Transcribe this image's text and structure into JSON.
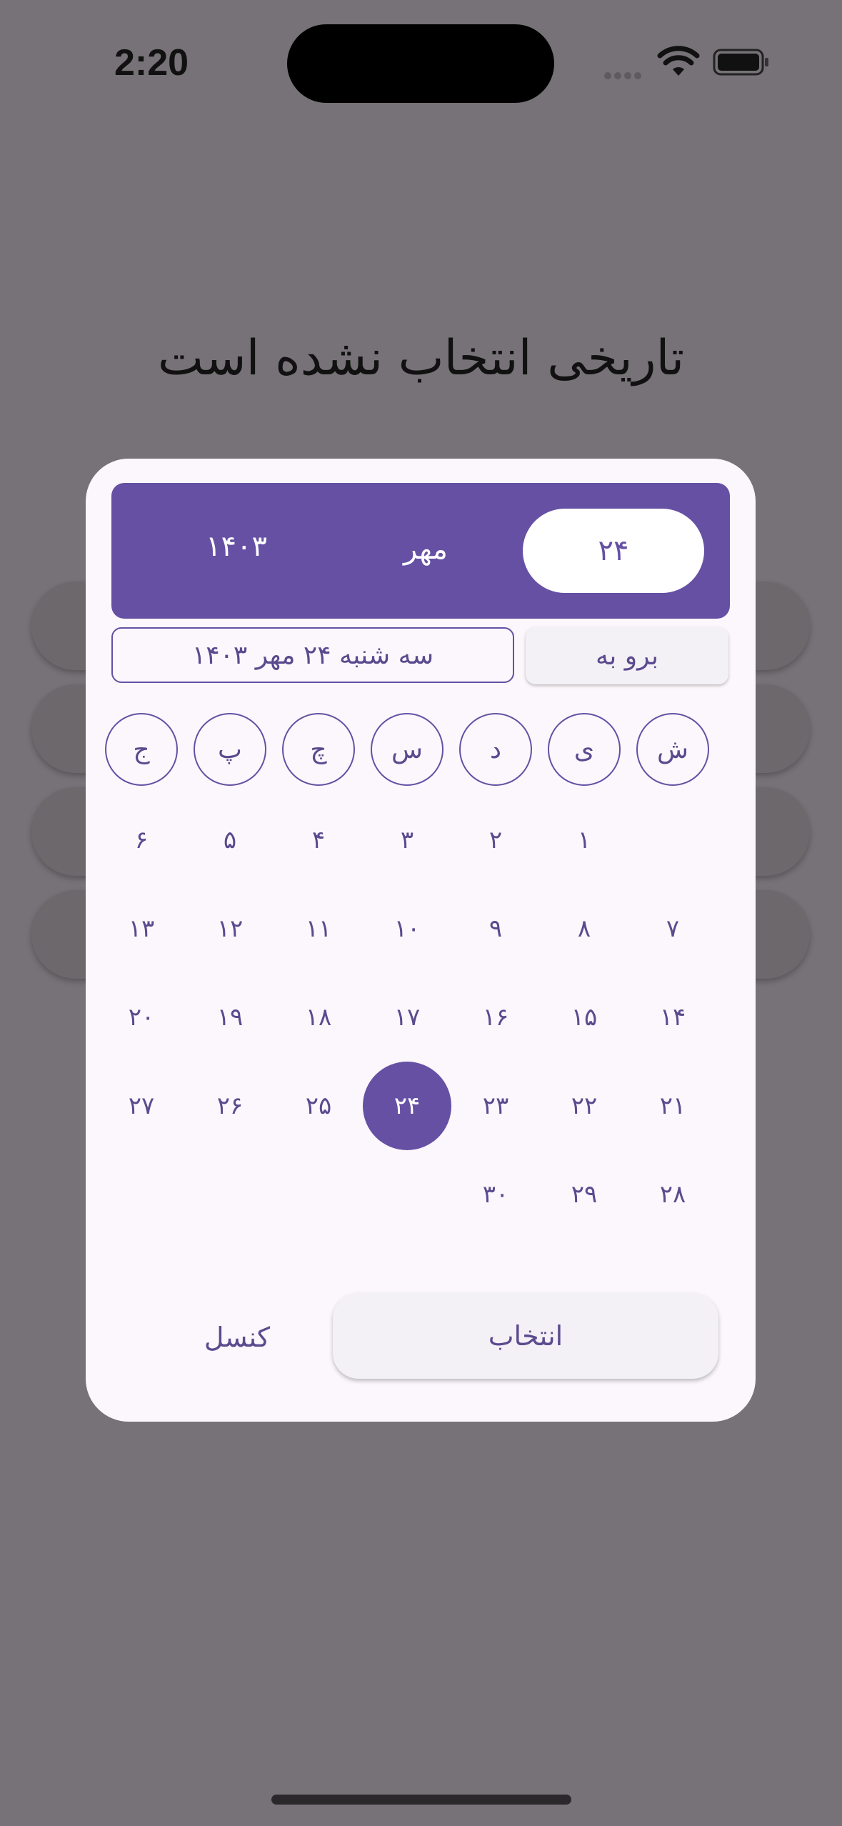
{
  "status_bar": {
    "time": "2:20"
  },
  "page_title": "تاریخی انتخاب نشده است",
  "header": {
    "day": "۲۴",
    "month": "مهر",
    "year": "۱۴۰۳"
  },
  "date_field": "سه شنبه ۲۴ مهر ۱۴۰۳",
  "goto_label": "برو به",
  "weekdays": [
    "ش",
    "ی",
    "د",
    "س",
    "چ",
    "پ",
    "ج"
  ],
  "days": [
    [
      "",
      "۱",
      "۲",
      "۳",
      "۴",
      "۵",
      "۶"
    ],
    [
      "۷",
      "۸",
      "۹",
      "۱۰",
      "۱۱",
      "۱۲",
      "۱۳"
    ],
    [
      "۱۴",
      "۱۵",
      "۱۶",
      "۱۷",
      "۱۸",
      "۱۹",
      "۲۰"
    ],
    [
      "۲۱",
      "۲۲",
      "۲۳",
      "۲۴",
      "۲۵",
      "۲۶",
      "۲۷"
    ],
    [
      "۲۸",
      "۲۹",
      "۳۰",
      "",
      "",
      "",
      ""
    ]
  ],
  "selected_day": "۲۴",
  "actions": {
    "select": "انتخاب",
    "cancel": "کنسل"
  },
  "colors": {
    "primary": "#6650a4",
    "scrim": "#777277",
    "dialog": "#fcf7fc"
  }
}
